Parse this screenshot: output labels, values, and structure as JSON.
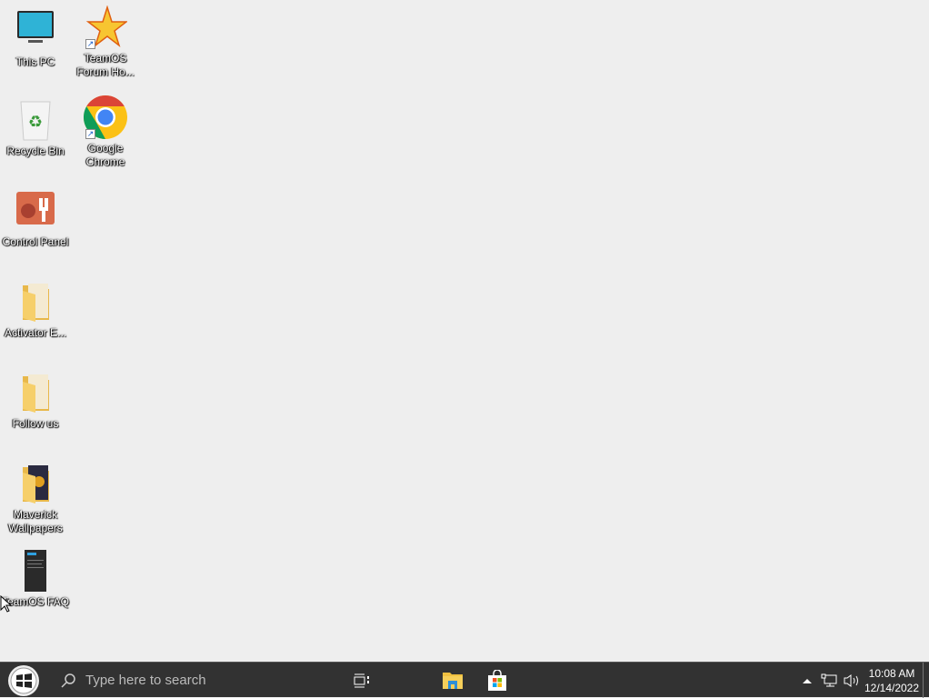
{
  "desktop_icons": [
    {
      "label": "This PC",
      "icon": "monitor-icon"
    },
    {
      "label": "TeamOS Forum Ho...",
      "icon": "star-shortcut-icon"
    },
    {
      "label": "Recycle Bin",
      "icon": "recycle-bin-icon"
    },
    {
      "label": "Google Chrome",
      "icon": "chrome-icon"
    },
    {
      "label": "Control Panel",
      "icon": "control-panel-icon"
    },
    {
      "label": "Activator E...",
      "icon": "folder-icon"
    },
    {
      "label": "Follow us",
      "icon": "folder-icon"
    },
    {
      "label": "Maverick Wallpapers",
      "icon": "folder-icon"
    },
    {
      "label": "TeamOS FAQ",
      "icon": "document-icon"
    }
  ],
  "taskbar": {
    "search_placeholder": "Type here to search",
    "time": "10:08 AM",
    "date": "12/14/2022"
  }
}
